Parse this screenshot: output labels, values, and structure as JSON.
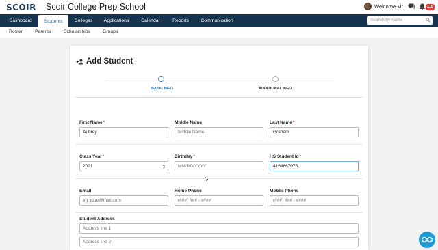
{
  "header": {
    "logo": "SCOIR",
    "school_name": "Scoir College Prep School",
    "welcome": "Welcome Mr.",
    "notification_count": "119"
  },
  "nav": {
    "items": [
      {
        "label": "Dashboard"
      },
      {
        "label": "Students"
      },
      {
        "label": "Colleges"
      },
      {
        "label": "Applications"
      },
      {
        "label": "Calendar"
      },
      {
        "label": "Reports"
      },
      {
        "label": "Communication"
      }
    ],
    "active": "Students",
    "search_placeholder": "Search by name"
  },
  "subnav": {
    "items": [
      {
        "label": "Roster"
      },
      {
        "label": "Parents"
      },
      {
        "label": "Scholarships"
      },
      {
        "label": "Groups"
      }
    ]
  },
  "form": {
    "title": "Add Student",
    "steps": [
      {
        "label": "BASIC INFO",
        "active": true
      },
      {
        "label": "ADDITIONAL INFO",
        "active": false
      }
    ],
    "first_name": {
      "label": "First Name",
      "value": "Aubrey"
    },
    "middle_name": {
      "label": "Middle Name",
      "placeholder": "Middle Name"
    },
    "last_name": {
      "label": "Last Name",
      "value": "Graham"
    },
    "class_year": {
      "label": "Class Year",
      "value": "2021"
    },
    "birthday": {
      "label": "Birthday",
      "placeholder": "MM/DD/YYYY"
    },
    "hs_student_id": {
      "label": "HS Student Id",
      "value": "4164667075"
    },
    "email": {
      "label": "Email",
      "placeholder": "eg: jdoe@mail.com"
    },
    "home_phone": {
      "label": "Home Phone",
      "placeholder": "(###) ### - ####"
    },
    "mobile_phone": {
      "label": "Mobile Phone",
      "placeholder": "(###) ### - ####"
    },
    "address": {
      "label": "Student Address",
      "line1_placeholder": "Address line 1",
      "line2_placeholder": "Address line 2"
    },
    "required_marker": "*"
  },
  "colors": {
    "nav_bg": "#16344f",
    "accent": "#1d71b8",
    "required": "#e53935",
    "fab": "#1d9bd7"
  }
}
